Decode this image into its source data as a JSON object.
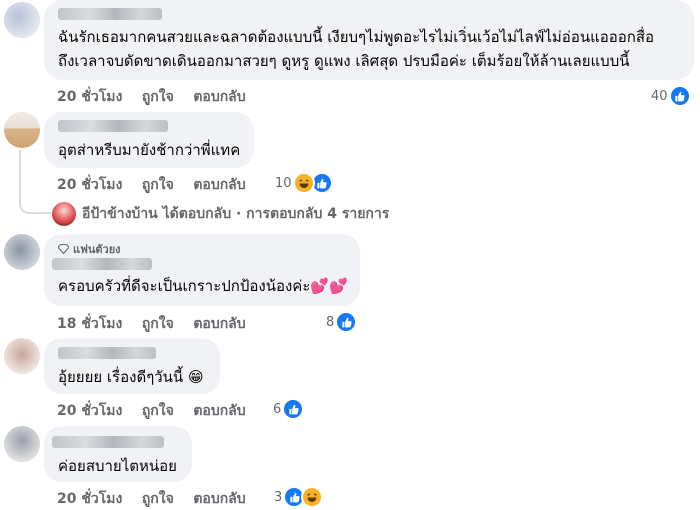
{
  "comments": [
    {
      "lines": [
        "ฉันรักเธอมากคนสวยและฉลาดต้องแบบนี้ เงียบๆไม่พูดอะไรไม่เวิ่นเว้อไม่ไลฟ์ไม่อ่อนแอออกสื่อ",
        "ถึงเวลาจบดัดขาดเดินออกมาสวยๆ ดูหรู ดูแพง เลิศสุด ปรบมือค่ะ เต็มร้อยให้ล้านเลยแบบนี้"
      ],
      "time": "20 ชั่วโมง",
      "like": "ถูกใจ",
      "reply": "ตอบกลับ",
      "count": "40"
    },
    {
      "lines": [
        "อุตส่าหรีบมายังช้ากว่าพี่แทค"
      ],
      "time": "20 ชั่วโมง",
      "like": "ถูกใจ",
      "reply": "ตอบกลับ",
      "count": "10"
    },
    {
      "badge": "แฟนตัวยง",
      "lines": [
        "ครอบครัวที่ดีจะเป็นเกราะปกป้องน้องค่ะ💕💕"
      ],
      "time": "18 ชั่วโมง",
      "like": "ถูกใจ",
      "reply": "ตอบกลับ",
      "count": "8"
    },
    {
      "lines": [
        "อุ้ยยยย เรื่องดีๆวันนี้ 😁"
      ],
      "time": "20 ชั่วโมง",
      "like": "ถูกใจ",
      "reply": "ตอบกลับ",
      "count": "6"
    },
    {
      "lines": [
        "ค่อยสบายไตหน่อย"
      ],
      "time": "20 ชั่วโมง",
      "like": "ถูกใจ",
      "reply": "ตอบกลับ",
      "count": "3"
    }
  ],
  "reply_summary": "อีป้าข้างบ้าน ได้ตอบกลับ · การตอบกลับ 4 รายการ",
  "colors": {
    "like_blue": "#1877f2",
    "haha_yellow": "#f7b125",
    "bubble": "#f0f2f5",
    "meta": "#65676b"
  },
  "icons": [
    "like-icon",
    "haha-icon",
    "diamond-icon",
    "reply-arrow-icon"
  ]
}
